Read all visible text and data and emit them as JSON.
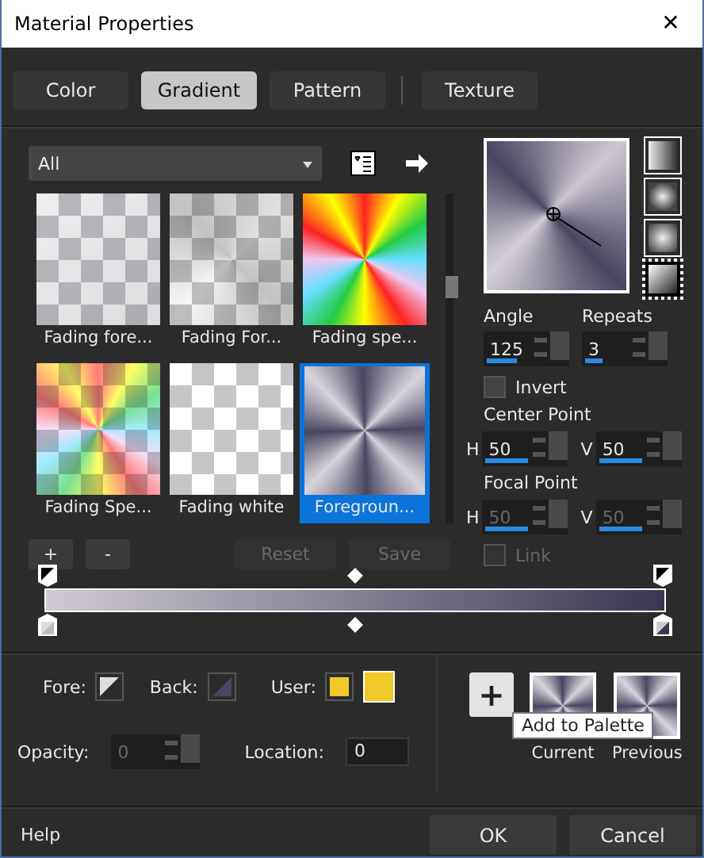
{
  "window": {
    "title": "Material Properties",
    "close": "✕"
  },
  "tabs": [
    {
      "label": "Color",
      "selected": false
    },
    {
      "label": "Gradient",
      "selected": true
    },
    {
      "label": "Pattern",
      "selected": false
    },
    {
      "label": "Texture",
      "selected": false
    }
  ],
  "category": {
    "value": "All"
  },
  "gradients": [
    {
      "name": "Fading fore...",
      "kind": "fading_grey",
      "selected": false
    },
    {
      "name": "Fading For...",
      "kind": "fading_metal",
      "selected": false
    },
    {
      "name": "Fading spe...",
      "kind": "spectrum",
      "selected": false
    },
    {
      "name": "Fading Spe...",
      "kind": "spectrum_fade",
      "selected": false
    },
    {
      "name": "Fading white",
      "kind": "fading_white",
      "selected": false
    },
    {
      "name": "Foregroun...",
      "kind": "metal",
      "selected": true
    }
  ],
  "styles": [
    {
      "kind": "linear",
      "selected": false
    },
    {
      "kind": "rectangular",
      "selected": false
    },
    {
      "kind": "radial",
      "selected": false
    },
    {
      "kind": "sunburst",
      "selected": true
    }
  ],
  "angle": {
    "label": "Angle",
    "value": "125",
    "level": 0.35
  },
  "repeats": {
    "label": "Repeats",
    "value": "3",
    "level": 0.2
  },
  "invert": {
    "label": "Invert",
    "checked": false
  },
  "center_point": {
    "label": "Center Point",
    "fields": [
      {
        "axis": "H",
        "value": "50",
        "level": 0.5,
        "disabled": false
      },
      {
        "axis": "V",
        "value": "50",
        "level": 0.5,
        "disabled": false
      }
    ]
  },
  "focal_point": {
    "label": "Focal Point",
    "fields": [
      {
        "axis": "H",
        "value": "50",
        "level": 0.5,
        "disabled": true
      },
      {
        "axis": "V",
        "value": "50",
        "level": 0.5,
        "disabled": true
      }
    ]
  },
  "link": {
    "label": "Link",
    "checked": false,
    "disabled": true
  },
  "list_buttons": [
    {
      "label": "+",
      "disabled": false
    },
    {
      "label": "-",
      "disabled": false
    },
    {
      "label": "Reset",
      "disabled": true
    },
    {
      "label": "Save",
      "disabled": true
    }
  ],
  "stops": {
    "fore": "Fore:",
    "back": "Back:",
    "user": "User:"
  },
  "opacity": {
    "label": "Opacity:",
    "value": "0",
    "disabled": true
  },
  "location": {
    "label": "Location:",
    "value": "0"
  },
  "palette": {
    "add": "+",
    "current": "Current",
    "previous": "Previous",
    "tooltip": "Add to Palette"
  },
  "footer": {
    "help": "Help",
    "ok": "OK",
    "cancel": "Cancel"
  }
}
